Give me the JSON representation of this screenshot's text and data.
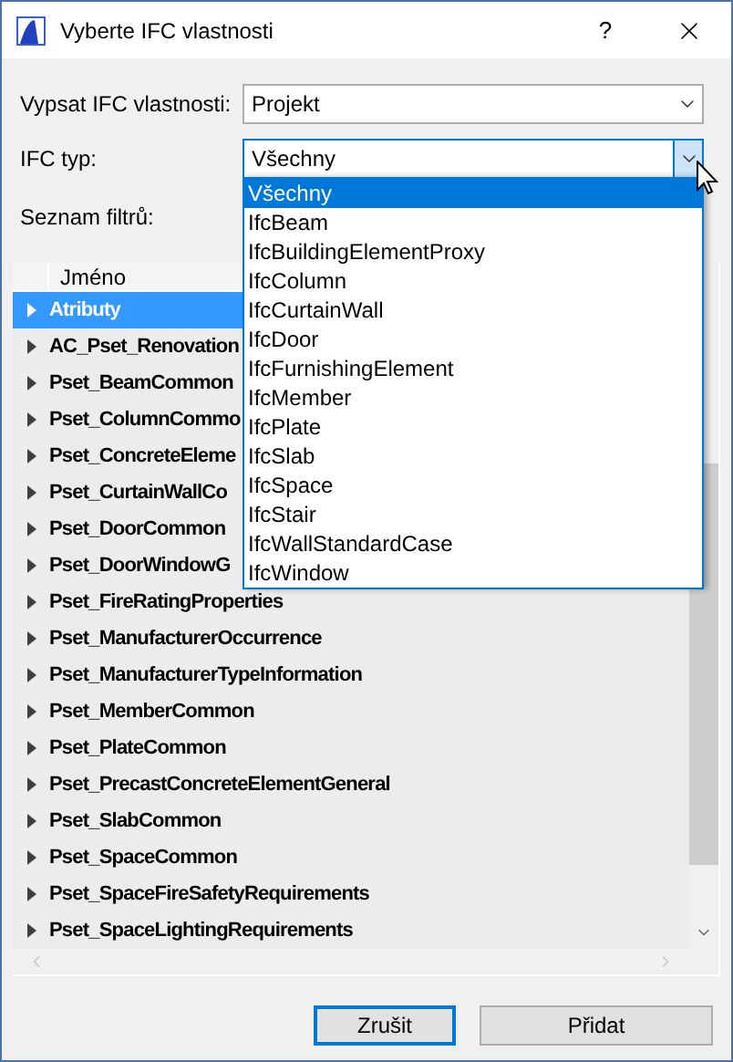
{
  "window": {
    "title": "Vyberte IFC vlastnosti",
    "help": "?"
  },
  "fields": [
    {
      "label": "Vypsat IFC vlastnosti:",
      "value": "Projekt",
      "open": false
    },
    {
      "label": "IFC typ:",
      "value": "Všechny",
      "open": true,
      "options": [
        {
          "label": "Všechny",
          "selected": true
        },
        {
          "label": "IfcBeam",
          "selected": false
        },
        {
          "label": "IfcBuildingElementProxy",
          "selected": false
        },
        {
          "label": "IfcColumn",
          "selected": false
        },
        {
          "label": "IfcCurtainWall",
          "selected": false
        },
        {
          "label": "IfcDoor",
          "selected": false
        },
        {
          "label": "IfcFurnishingElement",
          "selected": false
        },
        {
          "label": "IfcMember",
          "selected": false
        },
        {
          "label": "IfcPlate",
          "selected": false
        },
        {
          "label": "IfcSlab",
          "selected": false
        },
        {
          "label": "IfcSpace",
          "selected": false
        },
        {
          "label": "IfcStair",
          "selected": false
        },
        {
          "label": "IfcWallStandardCase",
          "selected": false
        },
        {
          "label": "IfcWindow",
          "selected": false
        }
      ]
    }
  ],
  "filter_list": {
    "label": "Seznam filtrů:",
    "column": "Jméno",
    "items": [
      {
        "label": "Atributy",
        "selected": true
      },
      {
        "label": "AC_Pset_Renovation",
        "selected": false
      },
      {
        "label": "Pset_BeamCommon",
        "selected": false
      },
      {
        "label": "Pset_ColumnCommo",
        "selected": false
      },
      {
        "label": "Pset_ConcreteEleme",
        "selected": false
      },
      {
        "label": "Pset_CurtainWallCo",
        "selected": false
      },
      {
        "label": "Pset_DoorCommon",
        "selected": false
      },
      {
        "label": "Pset_DoorWindowG",
        "selected": false
      },
      {
        "label": "Pset_FireRatingProperties",
        "selected": false
      },
      {
        "label": "Pset_ManufacturerOccurrence",
        "selected": false
      },
      {
        "label": "Pset_ManufacturerTypeInformation",
        "selected": false
      },
      {
        "label": "Pset_MemberCommon",
        "selected": false
      },
      {
        "label": "Pset_PlateCommon",
        "selected": false
      },
      {
        "label": "Pset_PrecastConcreteElementGeneral",
        "selected": false
      },
      {
        "label": "Pset_SlabCommon",
        "selected": false
      },
      {
        "label": "Pset_SpaceCommon",
        "selected": false
      },
      {
        "label": "Pset_SpaceFireSafetyRequirements",
        "selected": false
      },
      {
        "label": "Pset_SpaceLightingRequirements",
        "selected": false
      }
    ]
  },
  "buttons": [
    {
      "label": "Zrušit",
      "focused": true
    },
    {
      "label": "Přidat",
      "focused": false
    }
  ]
}
